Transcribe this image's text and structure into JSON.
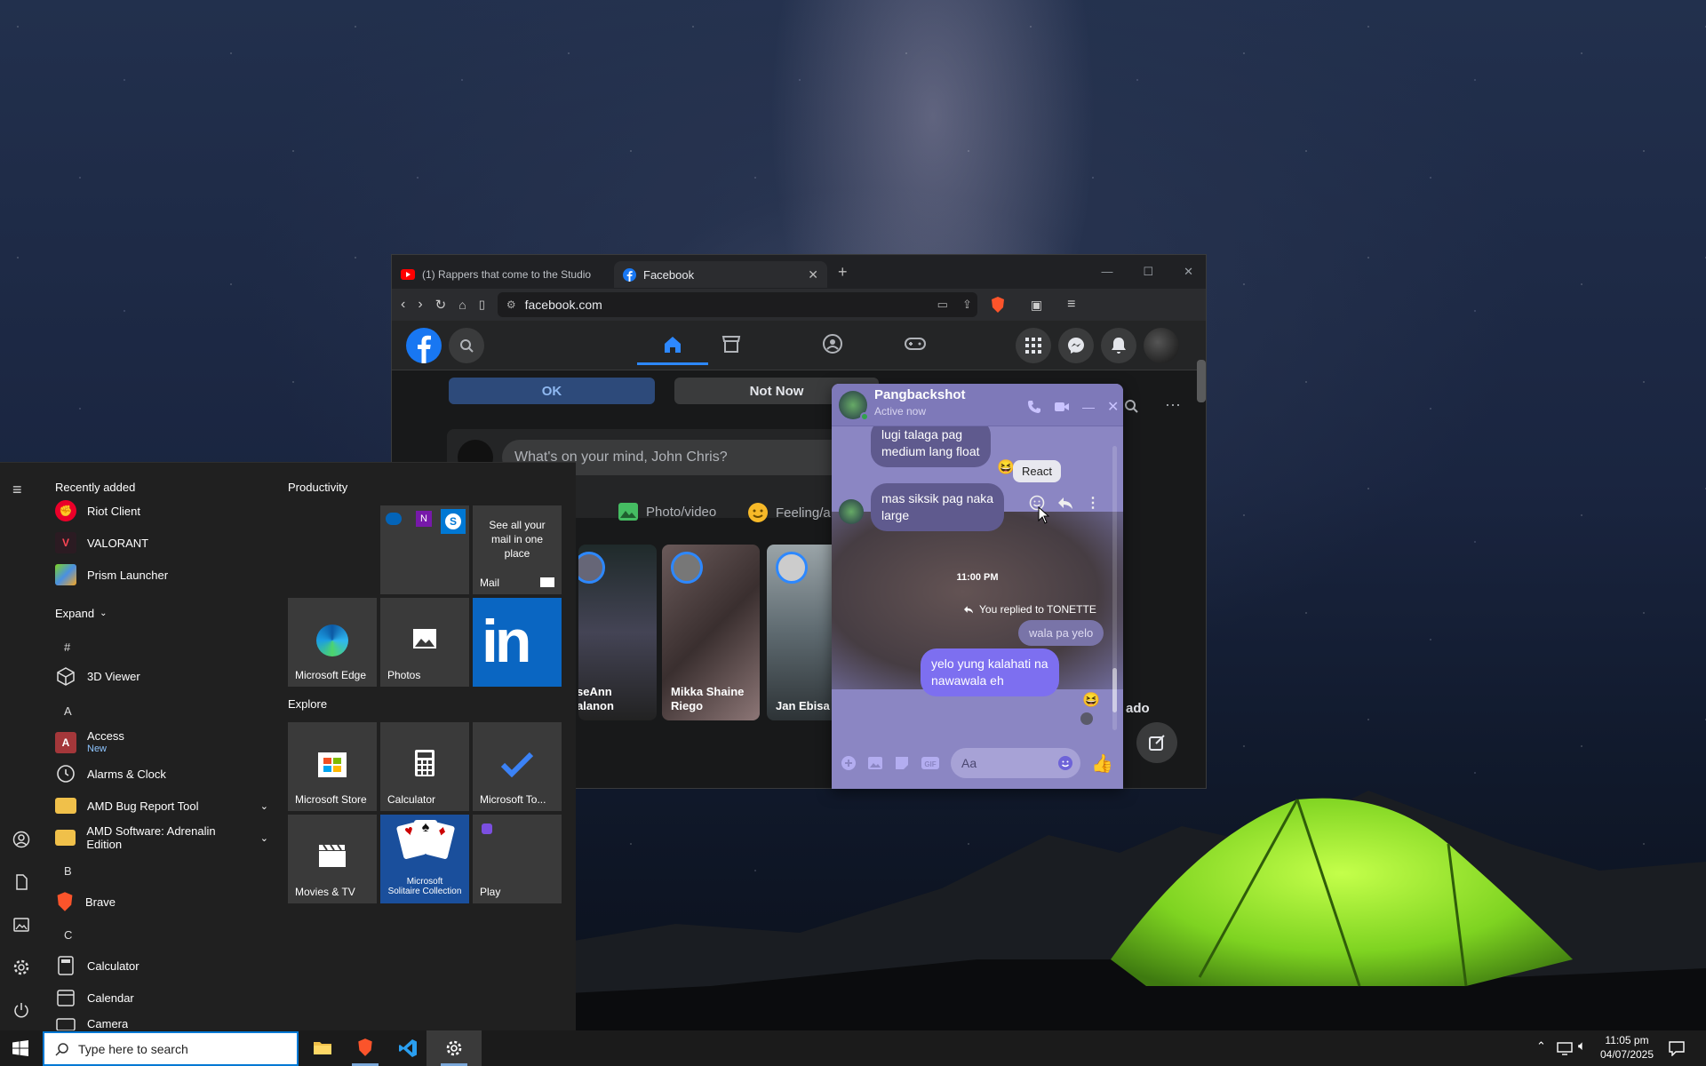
{
  "browser": {
    "tabs": [
      {
        "label": "(1) Rappers that come to the Studio"
      },
      {
        "label": "Facebook"
      }
    ],
    "url": "facebook.com"
  },
  "facebook": {
    "ok_button": "OK",
    "not_now_button": "Not Now",
    "composer_placeholder": "What's on your mind, John Chris?",
    "photo_video": "Photo/video",
    "feeling": "Feeling/a",
    "stories": [
      {
        "name": "seAnn\nalanon"
      },
      {
        "name": "Mikka Shaine\nRiego"
      },
      {
        "name": "Jan Ebisa"
      }
    ],
    "right_partial_text": "ado"
  },
  "chat": {
    "contact": "Pangbackshot",
    "status": "Active now",
    "react_tooltip": "React",
    "messages": {
      "top_partial": "lugi talaga pag\nmedium lang float",
      "received": "mas siksik pag naka\nlarge",
      "timestamp": "11:00 PM",
      "replied_label": "You replied to TONETTE",
      "quoted": "wala pa yelo",
      "sent": "yelo yung kalahati na\nnawawala eh"
    },
    "input_placeholder": "Aa"
  },
  "start_menu": {
    "recently_added_header": "Recently added",
    "recent_apps": [
      "Riot Client",
      "VALORANT",
      "Prism Launcher"
    ],
    "expand_label": "Expand",
    "letters": [
      "#",
      "A",
      "B",
      "C"
    ],
    "apps": {
      "viewer": "3D Viewer",
      "access": "Access",
      "access_badge": "New",
      "alarms": "Alarms & Clock",
      "amd_bug": "AMD Bug Report Tool",
      "amd_software": "AMD Software: Adrenalin Edition",
      "brave": "Brave",
      "calculator": "Calculator",
      "calendar": "Calendar",
      "camera": "Camera"
    },
    "productivity_header": "Productivity",
    "explore_header": "Explore",
    "tiles": {
      "mail_text": "See all your mail in one place",
      "mail": "Mail",
      "edge": "Microsoft Edge",
      "photos": "Photos",
      "store": "Microsoft Store",
      "calculator": "Calculator",
      "todo": "Microsoft To...",
      "movies": "Movies & TV",
      "solitaire": "Microsoft\nSolitaire Collection",
      "play": "Play"
    }
  },
  "taskbar": {
    "search_placeholder": "Type here to search",
    "time": "11:05 pm",
    "date": "04/07/2025"
  },
  "colors": {
    "facebook_blue": "#1877f2",
    "chat_bg": "#8b86c3",
    "sent_bubble": "#7d6ff0",
    "linkedin_tile": "#0a66c2"
  }
}
